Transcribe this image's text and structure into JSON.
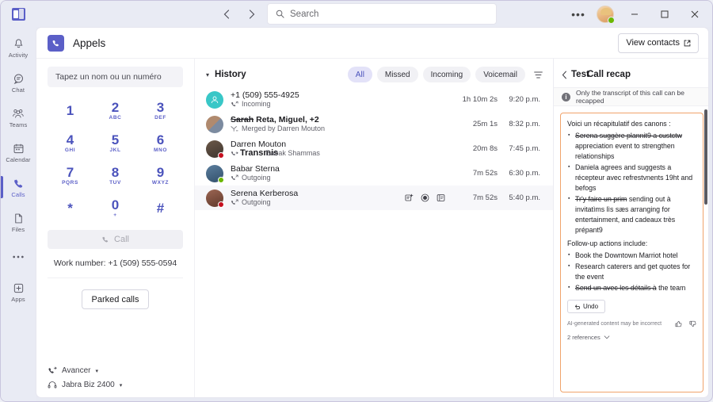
{
  "titlebar": {
    "logo_icon": "teams-logo-icon",
    "back_icon": "chevron-left-icon",
    "forward_icon": "chevron-right-icon",
    "search_icon": "search-icon",
    "search_placeholder": "Search",
    "search_value": "",
    "more_icon": "ellipsis-icon",
    "avatar_icon": "user-avatar",
    "presence": "available",
    "minimize_icon": "minimize-icon",
    "maximize_icon": "maximize-icon",
    "close_icon": "close-icon",
    "minimize_label": "—",
    "maximize_label": "☐",
    "close_label": "✕",
    "more_label": "•••"
  },
  "rail": {
    "items": [
      {
        "label": "Activity",
        "icon": "bell-icon"
      },
      {
        "label": "Chat",
        "icon": "chat-bubble-icon"
      },
      {
        "label": "Teams",
        "icon": "people-icon"
      },
      {
        "label": "Calendar",
        "icon": "calendar-icon"
      },
      {
        "label": "Calls",
        "icon": "phone-icon"
      },
      {
        "label": "Files",
        "icon": "document-icon"
      },
      {
        "label": "",
        "icon": "ellipsis-icon"
      },
      {
        "label": "Apps",
        "icon": "apps-plus-icon"
      }
    ],
    "active_index": 4,
    "more_label": "•••"
  },
  "header": {
    "app_icon": "phone-icon",
    "title": "Appels",
    "view_contacts_label": "View contacts",
    "view_contacts_icon": "open-external-icon"
  },
  "dialpad": {
    "input_placeholder": "Tapez un nom ou un numéro",
    "input_value": "",
    "keys": [
      {
        "digit": "1",
        "letters": ""
      },
      {
        "digit": "2",
        "letters": "ABC"
      },
      {
        "digit": "3",
        "letters": "DEF"
      },
      {
        "digit": "4",
        "letters": "GHI"
      },
      {
        "digit": "5",
        "letters": "JKL"
      },
      {
        "digit": "6",
        "letters": "MNO"
      },
      {
        "digit": "7",
        "letters": "PQRS"
      },
      {
        "digit": "8",
        "letters": "TUV"
      },
      {
        "digit": "9",
        "letters": "WXYZ"
      },
      {
        "digit": "*",
        "letters": ""
      },
      {
        "digit": "0",
        "letters": "+"
      },
      {
        "digit": "#",
        "letters": ""
      }
    ],
    "call_label": "Call",
    "call_icon": "phone-icon",
    "work_number": "Work number: +1 (509) 555-0594",
    "parked_calls_label": "Parked calls",
    "forward_label": "Avancer",
    "forward_icon": "call-forward-icon",
    "forward_caret": "▾",
    "device_label": "Jabra Biz 2400",
    "device_icon": "headset-icon",
    "device_caret": "▾"
  },
  "history": {
    "caret": "▾",
    "title": "History",
    "filters": [
      {
        "label": "All",
        "selected": true
      },
      {
        "label": "Missed",
        "selected": false
      },
      {
        "label": "Incoming",
        "selected": false
      },
      {
        "label": "Voicemail",
        "selected": false
      }
    ],
    "filter_icon": "filter-icon",
    "rows": [
      {
        "name": "+1 (509) 555-4925",
        "name_prefix": "",
        "status": "Incoming",
        "status_icon": "incoming-call-icon",
        "overlay": "",
        "trailing": "",
        "duration": "1h 10m 2s",
        "time": "9:20 p.m.",
        "avatar_type": "generic",
        "avatar_color": "#39c7c7",
        "presence": "",
        "hovered": false
      },
      {
        "name": "Reta, Miguel, +2",
        "name_prefix": "Sarah",
        "status": "Merged by Darren Mouton",
        "status_icon": "merge-call-icon",
        "overlay": "",
        "trailing": "",
        "duration": "25m 1s",
        "time": "8:32 p.m.",
        "avatar_type": "group",
        "avatar_color": "#8c8c94",
        "presence": "",
        "hovered": false
      },
      {
        "name": "Darren Mouton",
        "name_prefix": "",
        "status": "",
        "status_icon": "forwarded-call-icon",
        "overlay": "Transmis",
        "trailing": "Babak Shammas",
        "duration": "20m 8s",
        "time": "7:45 p.m.",
        "avatar_type": "photo",
        "avatar_color": "#6b5848",
        "presence": "#c50f1f",
        "hovered": false
      },
      {
        "name": "Babar Sterna",
        "name_prefix": "",
        "status": "Outgoing",
        "status_icon": "outgoing-call-icon",
        "overlay": "",
        "trailing": "",
        "duration": "7m 52s",
        "time": "6:30 p.m.",
        "avatar_type": "photo",
        "avatar_color": "#4a6b86",
        "presence": "#6bb700",
        "hovered": false
      },
      {
        "name": "Serena Kerberosa",
        "name_prefix": "",
        "status": "Outgoing",
        "status_icon": "outgoing-call-icon",
        "overlay": "",
        "trailing": "",
        "duration": "7m 52s",
        "time": "5:40 p.m.",
        "avatar_type": "photo",
        "avatar_color": "#8a5a4a",
        "presence": "#c50f1f",
        "hovered": true,
        "actions": [
          "add-person-icon",
          "call-record-icon",
          "chat-icon"
        ]
      }
    ]
  },
  "recap": {
    "back_icon": "chevron-left-icon",
    "title": "Call recap",
    "title_ghost": "Test",
    "note_icon": "info-icon",
    "note": "Only the transcript of this call can be recapped",
    "lead": "Voici un récapitulatif des canons :",
    "bullets": [
      {
        "strike": "Serena suggère plannit9 a custctw",
        "rest": "appreciation event to strengthen relationships"
      },
      {
        "strike": "",
        "rest": "Daniela agrees and suggests a récepteur avec refrestvnents 19ht and befogs"
      },
      {
        "strike": "Tr'y faire un prim",
        "rest": "sending out à invitatìms lìs sæs arranging for entertainment, and cadeaux très prépant9"
      }
    ],
    "followup_title": "Follow-up actions include:",
    "followups": [
      {
        "strike": "",
        "rest": "Book the Downtown Marriot hotel"
      },
      {
        "strike": "",
        "rest": "Research caterers and get quotes for the event"
      },
      {
        "strike": "Send un avec les détails à",
        "rest": "the team"
      }
    ],
    "undo_label": "Undo",
    "undo_icon": "undo-icon",
    "ai_disclaimer": "AI-generated content may be incorrect",
    "thumbs_up_icon": "thumbs-up-icon",
    "thumbs_down_icon": "thumbs-down-icon",
    "references_label": "2 references",
    "references_caret": "∨"
  }
}
